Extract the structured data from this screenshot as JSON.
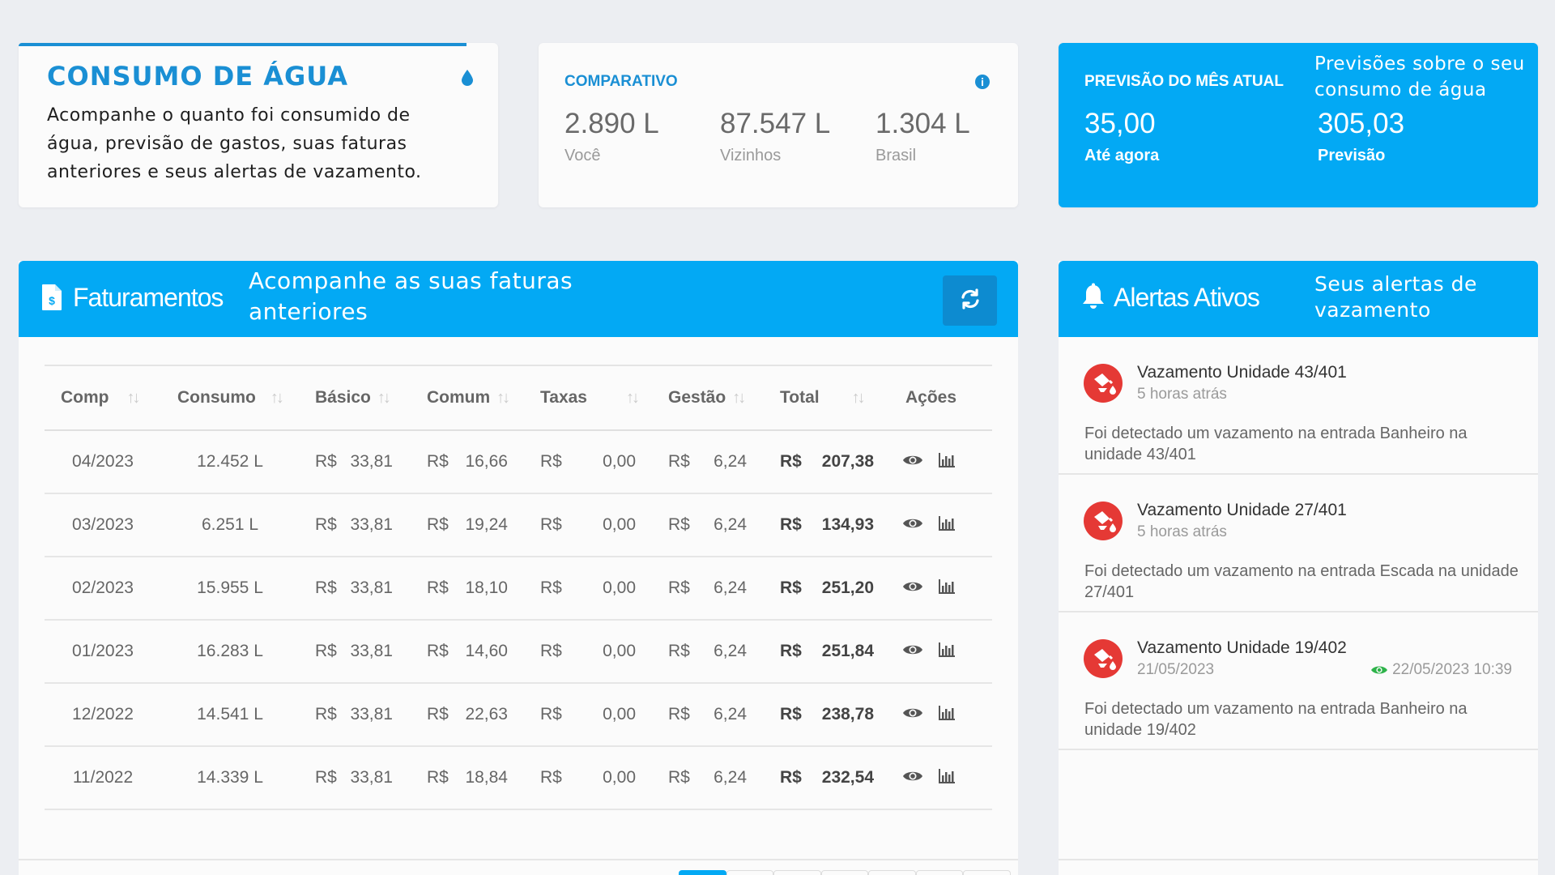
{
  "intro": {
    "title": "CONSUMO DE ÁGUA",
    "description": "Acompanhe o quanto foi consumido de água, previsão de gastos, suas faturas anteriores e seus alertas de vazamento.",
    "icon": "water-drop-icon"
  },
  "comparativo": {
    "label": "COMPARATIVO",
    "icon": "info-icon",
    "stats": [
      {
        "value": "2.890 L",
        "label": "Você"
      },
      {
        "value": "87.547 L",
        "label": "Vizinhos"
      },
      {
        "value": "1.304 L",
        "label": "Brasil"
      }
    ]
  },
  "previsao": {
    "label": "PREVISÃO DO MÊS ATUAL",
    "note": "Previsões sobre o seu consumo de água",
    "stats": [
      {
        "value": "35,00",
        "label": "Até agora"
      },
      {
        "value": "305,03",
        "label": "Previsão"
      }
    ]
  },
  "faturamentos": {
    "title": "Faturamentos",
    "note": "Acompanhe as suas faturas anteriores",
    "icon": "invoice-icon",
    "refresh_icon": "refresh-icon",
    "columns": [
      "Comp",
      "Consumo",
      "Básico",
      "Comum",
      "Taxas",
      "Gestão",
      "Total",
      "Ações"
    ],
    "currency": "R$",
    "rows": [
      {
        "comp": "04/2023",
        "consumo": "12.452 L",
        "basico": "33,81",
        "comum": "16,66",
        "taxas": "0,00",
        "gestao": "6,24",
        "total": "207,38"
      },
      {
        "comp": "03/2023",
        "consumo": "6.251 L",
        "basico": "33,81",
        "comum": "19,24",
        "taxas": "0,00",
        "gestao": "6,24",
        "total": "134,93"
      },
      {
        "comp": "02/2023",
        "consumo": "15.955 L",
        "basico": "33,81",
        "comum": "18,10",
        "taxas": "0,00",
        "gestao": "6,24",
        "total": "251,20"
      },
      {
        "comp": "01/2023",
        "consumo": "16.283 L",
        "basico": "33,81",
        "comum": "14,60",
        "taxas": "0,00",
        "gestao": "6,24",
        "total": "251,84"
      },
      {
        "comp": "12/2022",
        "consumo": "14.541 L",
        "basico": "33,81",
        "comum": "22,63",
        "taxas": "0,00",
        "gestao": "6,24",
        "total": "238,78"
      },
      {
        "comp": "11/2022",
        "consumo": "14.339 L",
        "basico": "33,81",
        "comum": "18,84",
        "taxas": "0,00",
        "gestao": "6,24",
        "total": "232,54"
      }
    ]
  },
  "alertas": {
    "title": "Alertas Ativos",
    "note": "Seus alertas de vazamento",
    "icon": "bell-icon",
    "items": [
      {
        "title": "Vazamento Unidade 43/401",
        "time": "5 horas atrás",
        "seen": "",
        "body": "Foi detectado um vazamento na entrada Banheiro na unidade 43/401"
      },
      {
        "title": "Vazamento Unidade 27/401",
        "time": "5 horas atrás",
        "seen": "",
        "body": "Foi detectado um vazamento na entrada Escada na unidade 27/401"
      },
      {
        "title": "Vazamento Unidade 19/402",
        "time": "21/05/2023",
        "seen": "22/05/2023 10:39",
        "body": "Foi detectado um vazamento na entrada Banheiro na unidade 19/402"
      }
    ]
  },
  "colors": {
    "accent": "#03a9f4",
    "title_blue": "#1a8fd4",
    "alert_red": "#e53935",
    "seen_green": "#2eb34a"
  }
}
